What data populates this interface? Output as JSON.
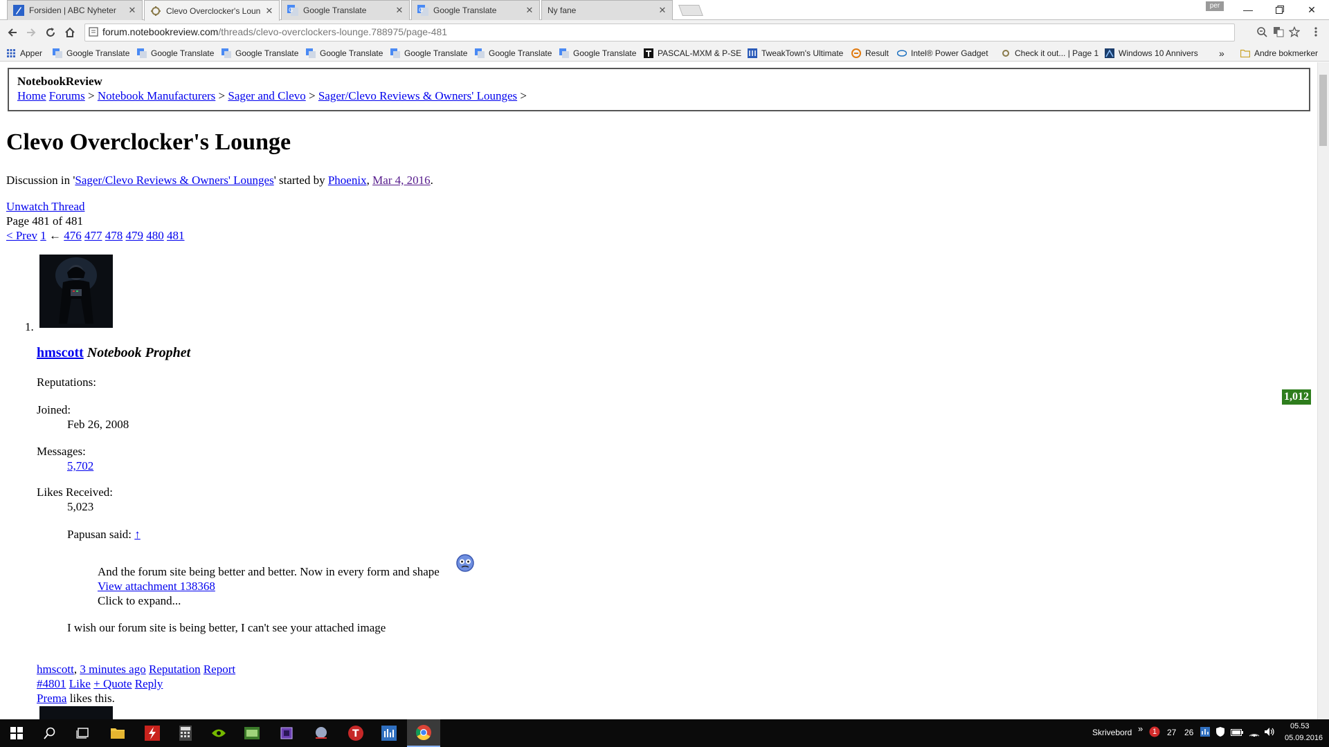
{
  "browser": {
    "tabs": [
      {
        "title": "Forsiden | ABC Nyheter",
        "icon": "abc-news-icon"
      },
      {
        "title": "Clevo Overclocker's Loun",
        "icon": "forum-icon"
      },
      {
        "title": "Google Translate",
        "icon": "google-translate-icon"
      },
      {
        "title": "Google Translate",
        "icon": "google-translate-icon"
      },
      {
        "title": "Ny fane",
        "icon": "none"
      }
    ],
    "profile_label": "per",
    "url_host": "forum.notebookreview.com",
    "url_path": "/threads/clevo-overclockers-lounge.788975/page-481",
    "bookmarks": [
      {
        "label": "Apper",
        "icon": "apps-grid-icon"
      },
      {
        "label": "Google Translate",
        "icon": "google-translate-icon"
      },
      {
        "label": "Google Translate",
        "icon": "google-translate-icon"
      },
      {
        "label": "Google Translate",
        "icon": "google-translate-icon"
      },
      {
        "label": "Google Translate",
        "icon": "google-translate-icon"
      },
      {
        "label": "Google Translate",
        "icon": "google-translate-icon"
      },
      {
        "label": "Google Translate",
        "icon": "google-translate-icon"
      },
      {
        "label": "Google Translate",
        "icon": "google-translate-icon"
      },
      {
        "label": "PASCAL-MXM & P-SE",
        "icon": "tt-icon"
      },
      {
        "label": "TweakTown's Ultimate",
        "icon": "tweaktown-icon"
      },
      {
        "label": "Result",
        "icon": "result-icon"
      },
      {
        "label": "Intel® Power Gadget",
        "icon": "intel-icon"
      },
      {
        "label": "Check it out... | Page 1",
        "icon": "gear-fav-icon"
      },
      {
        "label": "Windows 10 Annivers",
        "icon": "windows-fav-icon"
      }
    ],
    "bookmarks_overflow": "»",
    "other_bookmarks": "Andre bokmerker"
  },
  "page": {
    "site_name": "NotebookReview",
    "breadcrumbs": [
      "Home",
      "Forums",
      "Notebook Manufacturers",
      "Sager and Clevo",
      "Sager/Clevo Reviews & Owners' Lounges"
    ],
    "breadcrumb_sep": ">",
    "thread_title": "Clevo Overclocker's Lounge",
    "discussion_prefix": "Discussion in '",
    "discussion_forum": "Sager/Clevo Reviews & Owners' Lounges",
    "discussion_mid": "' started by ",
    "starter": "Phoenix",
    "comma": ",",
    "start_date": "Mar 4, 2016",
    "period": ".",
    "unwatch": "Unwatch Thread",
    "page_status": "Page 481 of 481",
    "pagination": {
      "prev": "< Prev",
      "first": "1",
      "gap": "←",
      "pages": [
        "476",
        "477",
        "478",
        "479",
        "480",
        "481"
      ]
    },
    "post": {
      "list_number": "1.",
      "username": "hmscott",
      "user_title": "Notebook Prophet",
      "reputation_label": "Reputations:",
      "reputation_value": "1,012",
      "joined_label": "Joined:",
      "joined_value": "Feb 26, 2008",
      "messages_label": "Messages:",
      "messages_value": "5,702",
      "likes_label": "Likes Received:",
      "likes_value": "5,023",
      "quote_author": "Papusan said:",
      "quote_jump": "↑",
      "quote_text": "And the forum site being better and better. Now in every form and shape",
      "quote_attachment": "View attachment 138368",
      "quote_expand": "Click to expand...",
      "body": "I wish our forum site is being better, I can't see your attached image",
      "meta_user": "hmscott",
      "meta_time": "3 minutes ago",
      "meta_reputation": "Reputation",
      "meta_report": "Report",
      "post_number": "#4801",
      "like": "Like",
      "quote": "+ Quote",
      "reply": "Reply",
      "liker": "Prema",
      "likes_suffix": "likes this."
    }
  },
  "taskbar": {
    "desktop_label": "Skrivebord",
    "tray_overflow": "»",
    "badge_count": "1",
    "temp1": "27",
    "temp2": "26",
    "time": "05.53",
    "date": "05.09.2016"
  }
}
